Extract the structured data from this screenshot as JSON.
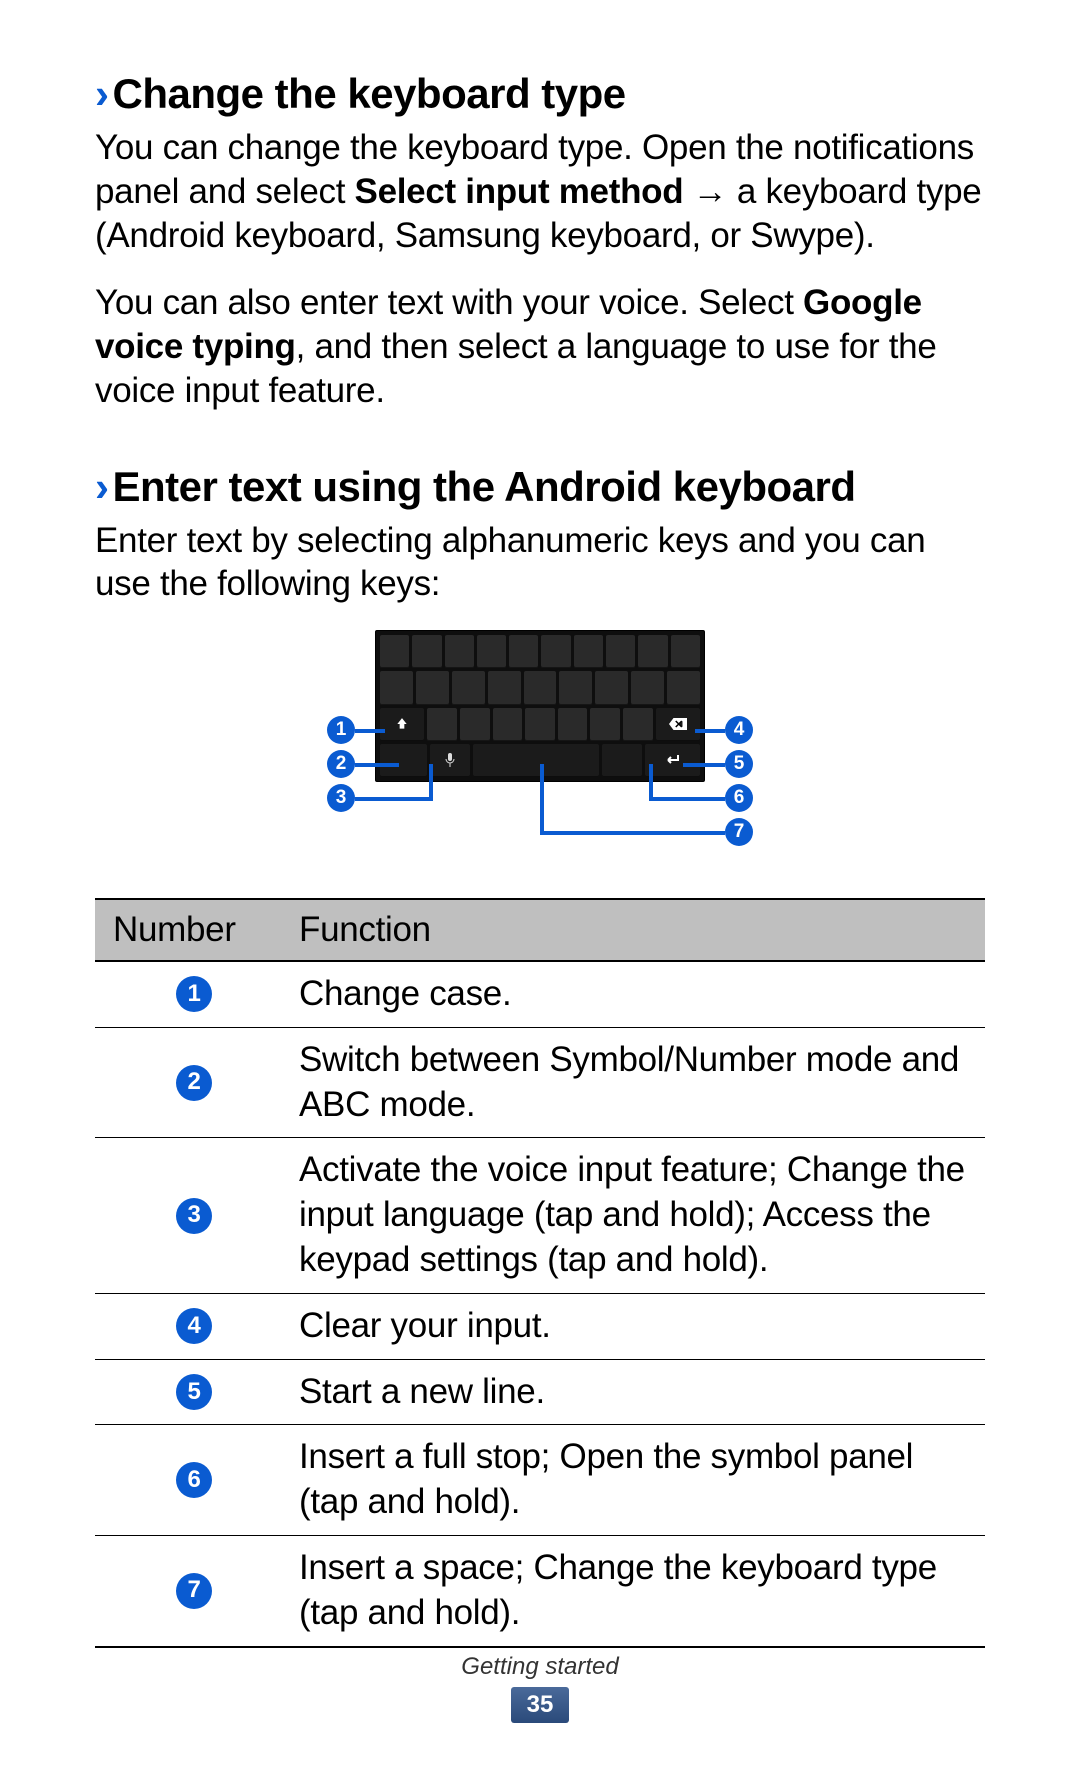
{
  "section1": {
    "chevron": "›",
    "title": "Change the keyboard type",
    "p1_a": "You can change the keyboard type. Open the notifications panel and select ",
    "p1_b": "Select input method",
    "p1_c": " → a keyboard type (Android keyboard, Samsung keyboard, or Swype).",
    "p2_a": "You can also enter text with your voice. Select ",
    "p2_b": "Google voice typing",
    "p2_c": ", and then select a language to use for the voice input feature."
  },
  "section2": {
    "chevron": "›",
    "title": "Enter text using the Android keyboard",
    "p1": "Enter text by selecting alphanumeric keys and you can use the following keys:"
  },
  "diagram": {
    "callouts": {
      "c1": "1",
      "c2": "2",
      "c3": "3",
      "c4": "4",
      "c5": "5",
      "c6": "6",
      "c7": "7"
    }
  },
  "table": {
    "head": {
      "number": "Number",
      "function": "Function"
    },
    "rows": [
      {
        "n": "1",
        "f": "Change case."
      },
      {
        "n": "2",
        "f": "Switch between Symbol/Number mode and ABC mode."
      },
      {
        "n": "3",
        "f": "Activate the voice input feature; Change the input language (tap and hold); Access the keypad settings (tap and hold)."
      },
      {
        "n": "4",
        "f": "Clear your input."
      },
      {
        "n": "5",
        "f": "Start a new line."
      },
      {
        "n": "6",
        "f": "Insert a full stop; Open the symbol panel (tap and hold)."
      },
      {
        "n": "7",
        "f": "Insert a space; Change the keyboard type (tap and hold)."
      }
    ]
  },
  "footer": {
    "section": "Getting started",
    "page": "35"
  }
}
